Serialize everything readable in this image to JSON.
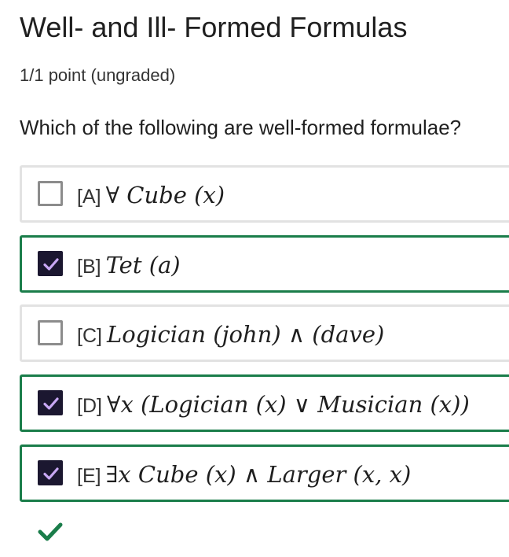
{
  "quiz": {
    "title": "Well- and Ill- Formed Formulas",
    "score": "1/1 point (ungraded)",
    "question": "Which of the following are well-formed formulae?",
    "options": [
      {
        "label": "[A]",
        "formula": "∀ Cube (x)",
        "checked": false
      },
      {
        "label": "[B]",
        "formula": "Tet (a)",
        "checked": true
      },
      {
        "label": "[C]",
        "formula": "Logician (john) ∧ (dave)",
        "checked": false
      },
      {
        "label": "[D]",
        "formula": "∀x  (Logician (x) ∨ Musician (x))",
        "checked": true
      },
      {
        "label": "[E]",
        "formula": "∃x Cube (x) ∧ Larger (x, x)",
        "checked": true
      }
    ],
    "result_icon": "checkmark-icon"
  },
  "colors": {
    "checked_border": "#1a7d4a",
    "unchecked_border": "#e2e2e2",
    "checkbox_fill": "#1b1730",
    "checkmark": "#c9a8f5",
    "correct": "#1a7d4a"
  }
}
